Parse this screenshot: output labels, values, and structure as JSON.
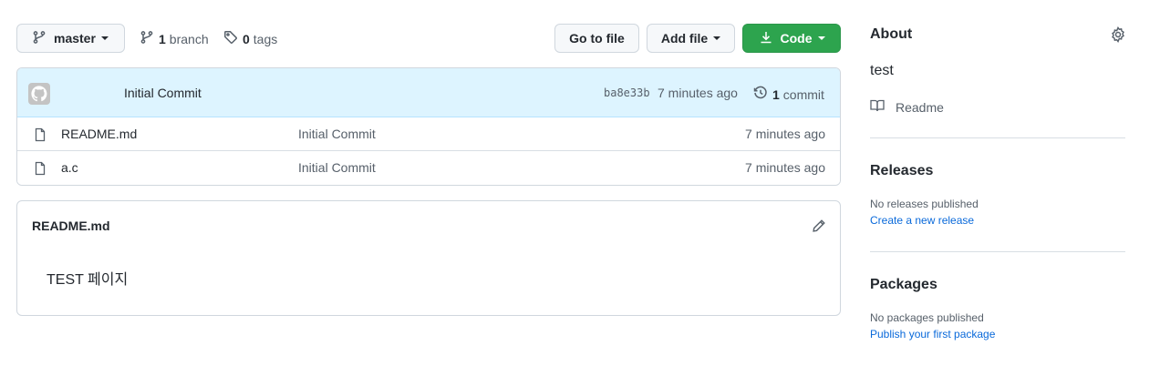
{
  "toolbar": {
    "branch_label": "master",
    "branches_count": "1",
    "branches_label": "branch",
    "tags_count": "0",
    "tags_label": "tags",
    "goto_file_label": "Go to file",
    "add_file_label": "Add file",
    "code_label": "Code"
  },
  "latest_commit": {
    "message": "Initial Commit",
    "sha": "ba8e33b",
    "time": "7 minutes ago",
    "count": "1",
    "count_label": "commit"
  },
  "files": [
    {
      "name": "README.md",
      "message": "Initial Commit",
      "time": "7 minutes ago"
    },
    {
      "name": "a.c",
      "message": "Initial Commit",
      "time": "7 minutes ago"
    }
  ],
  "readme": {
    "title": "README.md",
    "body": "TEST 페이지"
  },
  "sidebar": {
    "about_heading": "About",
    "description": "test",
    "readme_link": "Readme",
    "releases_heading": "Releases",
    "no_releases": "No releases published",
    "create_release": "Create a new release",
    "packages_heading": "Packages",
    "no_packages": "No packages published",
    "publish_package": "Publish your first package"
  },
  "colors": {
    "code_button": "#2da44e",
    "commit_bar": "#ddf4ff",
    "link": "#0969da"
  }
}
